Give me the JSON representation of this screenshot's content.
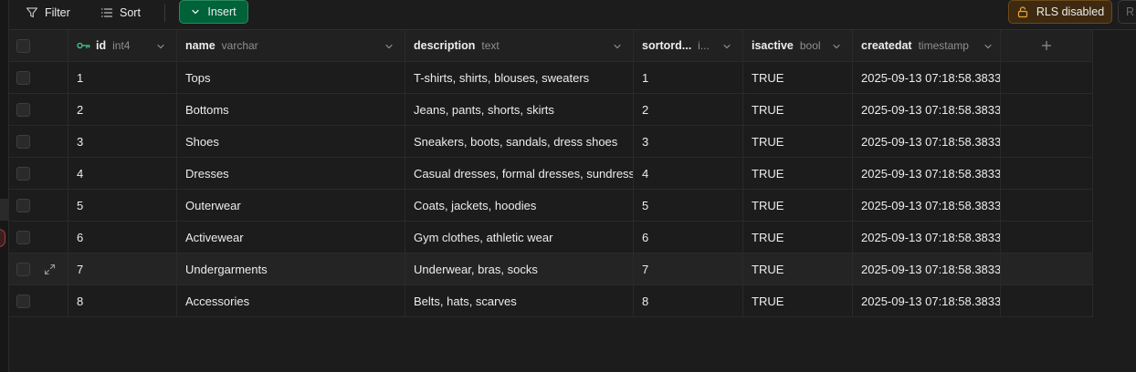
{
  "toolbar": {
    "filter_label": "Filter",
    "sort_label": "Sort",
    "insert_label": "Insert",
    "rls_label": "RLS disabled",
    "cut_label": "R"
  },
  "columns": [
    {
      "name": "id",
      "type": "int4",
      "primary_key": true
    },
    {
      "name": "name",
      "type": "varchar"
    },
    {
      "name": "description",
      "type": "text"
    },
    {
      "name": "sortord...",
      "type": "i..."
    },
    {
      "name": "isactive",
      "type": "bool"
    },
    {
      "name": "createdat",
      "type": "timestamp"
    }
  ],
  "rows": [
    {
      "id": "1",
      "name": "Tops",
      "description": "T-shirts, shirts, blouses, sweaters",
      "sortorder": "1",
      "isactive": "TRUE",
      "createdat": "2025-09-13 07:18:58.3833"
    },
    {
      "id": "2",
      "name": "Bottoms",
      "description": "Jeans, pants, shorts, skirts",
      "sortorder": "2",
      "isactive": "TRUE",
      "createdat": "2025-09-13 07:18:58.3833"
    },
    {
      "id": "3",
      "name": "Shoes",
      "description": "Sneakers, boots, sandals, dress shoes",
      "sortorder": "3",
      "isactive": "TRUE",
      "createdat": "2025-09-13 07:18:58.3833"
    },
    {
      "id": "4",
      "name": "Dresses",
      "description": "Casual dresses, formal dresses, sundresses",
      "sortorder": "4",
      "isactive": "TRUE",
      "createdat": "2025-09-13 07:18:58.3833"
    },
    {
      "id": "5",
      "name": "Outerwear",
      "description": "Coats, jackets, hoodies",
      "sortorder": "5",
      "isactive": "TRUE",
      "createdat": "2025-09-13 07:18:58.3833"
    },
    {
      "id": "6",
      "name": "Activewear",
      "description": "Gym clothes, athletic wear",
      "sortorder": "6",
      "isactive": "TRUE",
      "createdat": "2025-09-13 07:18:58.3833"
    },
    {
      "id": "7",
      "name": "Undergarments",
      "description": "Underwear, bras, socks",
      "sortorder": "7",
      "isactive": "TRUE",
      "createdat": "2025-09-13 07:18:58.3833"
    },
    {
      "id": "8",
      "name": "Accessories",
      "description": "Belts, hats, scarves",
      "sortorder": "8",
      "isactive": "TRUE",
      "createdat": "2025-09-13 07:18:58.3833"
    }
  ],
  "colors": {
    "insert_bg": "#006239",
    "rls_bg": "#3d2a10",
    "key_icon": "#3ecf8e"
  }
}
